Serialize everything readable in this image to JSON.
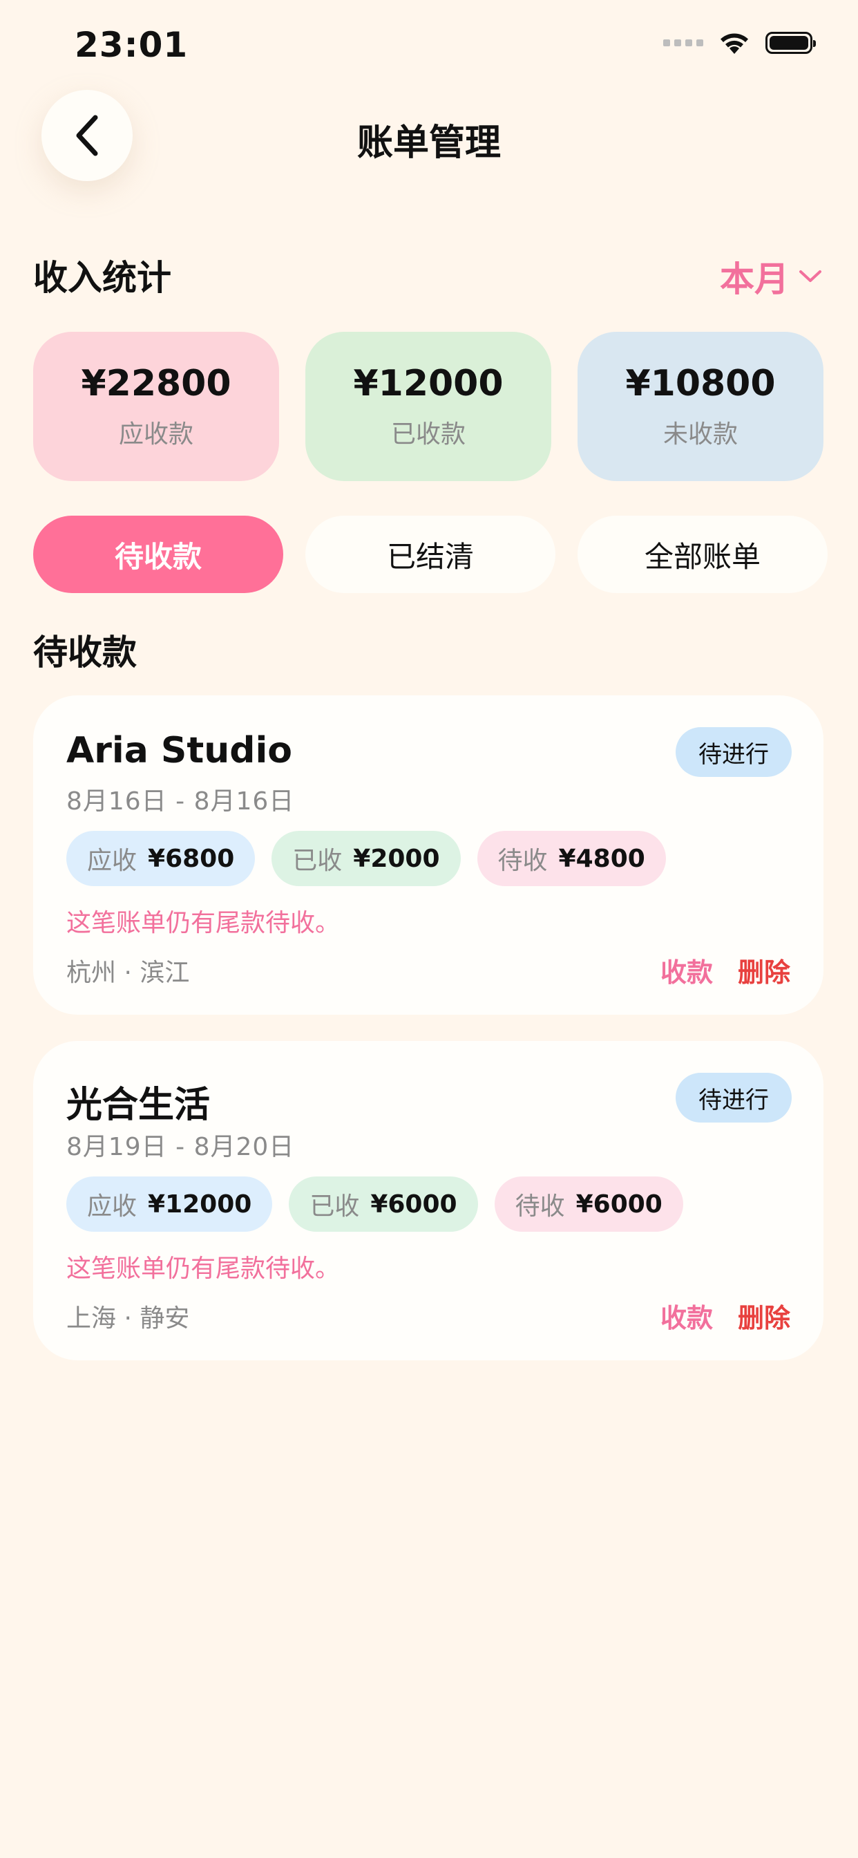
{
  "status_bar": {
    "time": "23:01"
  },
  "header": {
    "title": "账单管理",
    "back_icon": "chevron-left-icon"
  },
  "income_stats": {
    "title": "收入统计",
    "period_selector": "本月",
    "cards": [
      {
        "value": "¥22800",
        "label": "应收款",
        "color": "#FDD4DA"
      },
      {
        "value": "¥12000",
        "label": "已收款",
        "color": "#DAF0D8"
      },
      {
        "value": "¥10800",
        "label": "未收款",
        "color": "#D9E7F1"
      }
    ]
  },
  "tabs": [
    {
      "label": "待收款",
      "active": true
    },
    {
      "label": "已结清",
      "active": false
    },
    {
      "label": "全部账单",
      "active": false
    }
  ],
  "list": {
    "title": "待收款",
    "bills": [
      {
        "name": "Aria Studio",
        "status": "待进行",
        "dates": "8月16日 - 8月16日",
        "due_label": "应收",
        "due": "¥6800",
        "paid_label": "已收",
        "paid": "¥2000",
        "pending_label": "待收",
        "pending": "¥4800",
        "note": "这笔账单仍有尾款待收。",
        "location": "杭州 · 滨江",
        "collect_label": "收款",
        "delete_label": "删除"
      },
      {
        "name": "光合生活",
        "status": "待进行",
        "dates": "8月19日 - 8月20日",
        "due_label": "应收",
        "due": "¥12000",
        "paid_label": "已收",
        "paid": "¥6000",
        "pending_label": "待收",
        "pending": "¥6000",
        "note": "这笔账单仍有尾款待收。",
        "location": "上海 · 静安",
        "collect_label": "收款",
        "delete_label": "删除"
      }
    ]
  },
  "colors": {
    "background": "#FFF6EC",
    "accent_pink": "#FF7098",
    "delete_red": "#E8413F"
  }
}
